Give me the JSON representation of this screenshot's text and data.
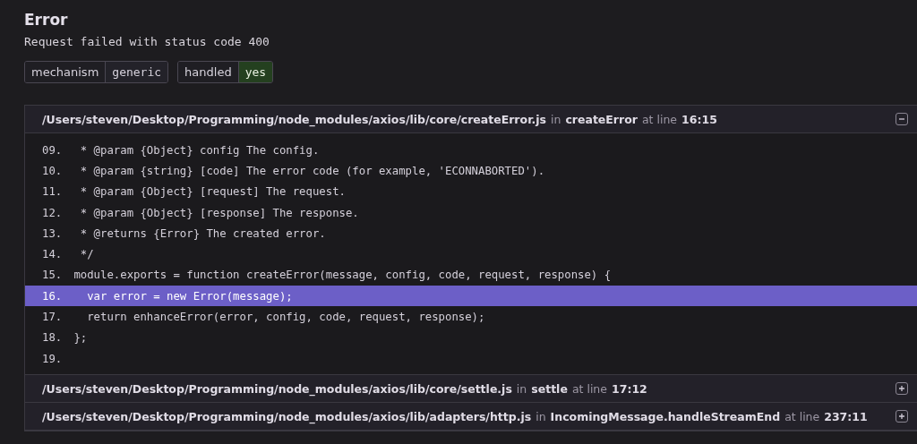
{
  "error": {
    "title": "Error",
    "message": "Request failed with status code 400"
  },
  "tags": [
    {
      "key": "mechanism",
      "value": "generic",
      "highlighted": false
    },
    {
      "key": "handled",
      "value": "yes",
      "highlighted": true
    }
  ],
  "frames": [
    {
      "file": "/Users/steven/Desktop/Programming/node_modules/axios/lib/core/createError.js",
      "in": "in",
      "function": "createError",
      "at": "at line",
      "location": "16:15",
      "expanded": true,
      "lines": [
        {
          "number": "09.",
          "code": "  * @param {Object} config The config.",
          "highlighted": false
        },
        {
          "number": "10.",
          "code": "  * @param {string} [code] The error code (for example, 'ECONNABORTED').",
          "highlighted": false
        },
        {
          "number": "11.",
          "code": "  * @param {Object} [request] The request.",
          "highlighted": false
        },
        {
          "number": "12.",
          "code": "  * @param {Object} [response] The response.",
          "highlighted": false
        },
        {
          "number": "13.",
          "code": "  * @returns {Error} The created error.",
          "highlighted": false
        },
        {
          "number": "14.",
          "code": "  */",
          "highlighted": false
        },
        {
          "number": "15.",
          "code": " module.exports = function createError(message, config, code, request, response) {",
          "highlighted": false
        },
        {
          "number": "16.",
          "code": "   var error = new Error(message);",
          "highlighted": true
        },
        {
          "number": "17.",
          "code": "   return enhanceError(error, config, code, request, response);",
          "highlighted": false
        },
        {
          "number": "18.",
          "code": " };",
          "highlighted": false
        },
        {
          "number": "19.",
          "highlighted": false
        }
      ]
    },
    {
      "file": "/Users/steven/Desktop/Programming/node_modules/axios/lib/core/settle.js",
      "in": "in",
      "function": "settle",
      "at": "at line",
      "location": "17:12",
      "expanded": false
    },
    {
      "file": "/Users/steven/Desktop/Programming/node_modules/axios/lib/adapters/http.js",
      "in": "in",
      "function": "IncomingMessage.handleStreamEnd",
      "at": "at line",
      "location": "237:11",
      "expanded": false
    }
  ]
}
